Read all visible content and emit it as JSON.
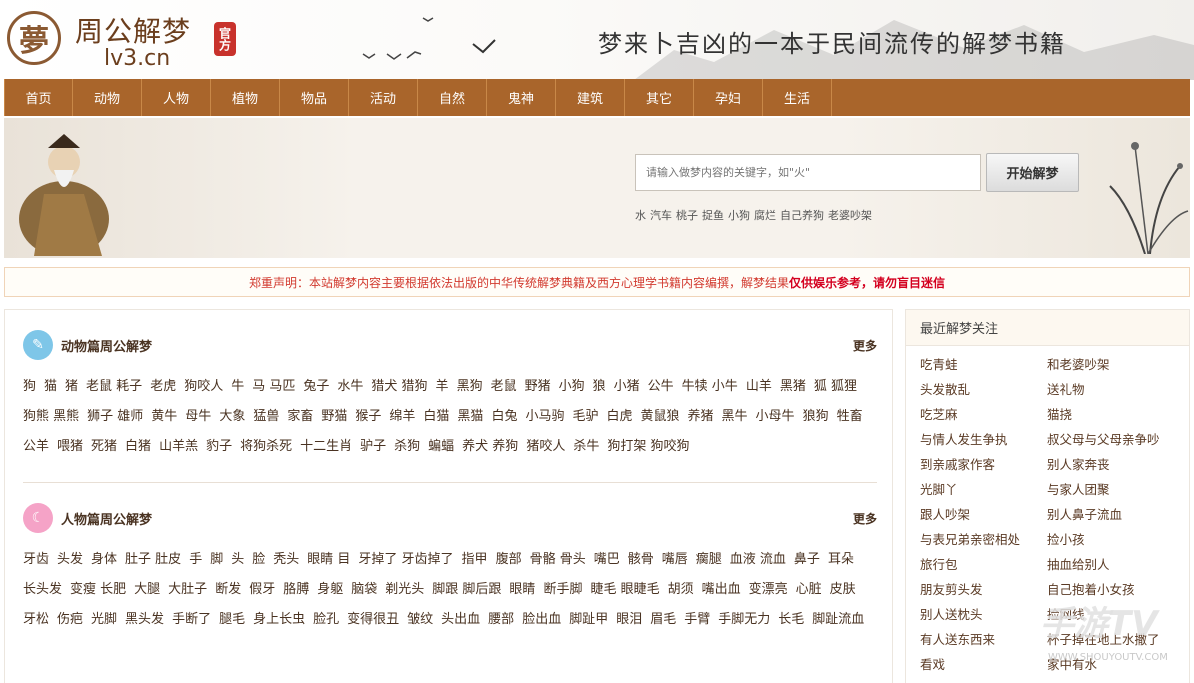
{
  "header": {
    "logo_char": "夢",
    "site_name": "周公解梦",
    "domain": "lv3.cn",
    "seal": "官方",
    "slogan": "梦来卜吉凶的一本于民间流传的解梦书籍"
  },
  "nav": {
    "items": [
      "首页",
      "动物",
      "人物",
      "植物",
      "物品",
      "活动",
      "自然",
      "鬼神",
      "建筑",
      "其它",
      "孕妇",
      "生活"
    ]
  },
  "search": {
    "placeholder": "请输入做梦内容的关键字，如\"火\"",
    "button_label": "开始解梦",
    "hot_keywords": [
      "水",
      "汽车",
      "桃子",
      "捉鱼",
      "小狗",
      "腐烂",
      "自己养狗",
      "老婆吵架"
    ]
  },
  "notice": {
    "text": "郑重声明：本站解梦内容主要根据依法出版的中华传统解梦典籍及西方心理学书籍内容编撰，解梦结果",
    "bold_text": "仅供娱乐参考，请勿盲目迷信"
  },
  "animals": {
    "title": "动物篇周公解梦",
    "more": "更多",
    "tags": [
      "狗",
      "猫",
      "猪",
      "老鼠 耗子",
      "老虎",
      "狗咬人",
      "牛",
      "马 马匹",
      "兔子",
      "水牛",
      "猎犬 猎狗",
      "羊",
      "黑狗",
      "老鼠",
      "野猪",
      "小狗",
      "狼",
      "小猪",
      "公牛",
      "牛犊 小牛",
      "山羊",
      "黑猪",
      "狐 狐狸",
      "狗熊 黑熊",
      "狮子 雄师",
      "黄牛",
      "母牛",
      "大象",
      "猛兽",
      "家畜",
      "野猫",
      "猴子",
      "绵羊",
      "白猫",
      "黑猫",
      "白兔",
      "小马驹",
      "毛驴",
      "白虎",
      "黄鼠狼",
      "养猪",
      "黑牛",
      "小母牛",
      "狼狗",
      "牲畜",
      "公羊",
      "喂猪",
      "死猪",
      "白猪",
      "山羊羔",
      "豹子",
      "将狗杀死",
      "十二生肖",
      "驴子",
      "杀狗",
      "蝙蝠",
      "养犬 养狗",
      "猪咬人",
      "杀牛",
      "狗打架 狗咬狗"
    ]
  },
  "people": {
    "title": "人物篇周公解梦",
    "more": "更多",
    "tags": [
      "牙齿",
      "头发",
      "身体",
      "肚子 肚皮",
      "手",
      "脚",
      "头",
      "脸",
      "秃头",
      "眼睛 目",
      "牙掉了 牙齿掉了",
      "指甲",
      "腹部",
      "骨骼 骨头",
      "嘴巴",
      "骸骨",
      "嘴唇",
      "瘸腿",
      "血液 流血",
      "鼻子",
      "耳朵",
      "长头发",
      "变瘦 长肥",
      "大腿",
      "大肚子",
      "断发",
      "假牙",
      "胳膊",
      "身躯",
      "脑袋",
      "剃光头",
      "脚跟 脚后跟",
      "眼睛",
      "断手脚",
      "睫毛 眼睫毛",
      "胡须",
      "嘴出血",
      "变漂亮",
      "心脏",
      "皮肤",
      "牙松",
      "伤疤",
      "光脚",
      "黑头发",
      "手断了",
      "腿毛",
      "身上长虫",
      "脸孔",
      "变得很丑",
      "皱纹",
      "头出血",
      "腰部",
      "脸出血",
      "脚趾甲",
      "眼泪",
      "眉毛",
      "手臂",
      "手脚无力",
      "长毛",
      "脚趾流血"
    ]
  },
  "sidebar": {
    "title": "最近解梦关注",
    "items": [
      "吃青蛙",
      "和老婆吵架",
      "头发散乱",
      "送礼物",
      "吃芝麻",
      "猫挠",
      "与情人发生争执",
      "叔父母与父母亲争吵",
      "到亲戚家作客",
      "别人家奔丧",
      "光脚丫",
      "与家人团聚",
      "跟人吵架",
      "别人鼻子流血",
      "与表兄弟亲密相处",
      "捡小孩",
      "旅行包",
      "抽血给别人",
      "朋友剪头发",
      "自己抱着小女孩",
      "别人送枕头",
      "捡网线",
      "有人送东西来",
      "杯子掉在地上水撒了",
      "看戏",
      "家中有水"
    ]
  },
  "watermark": {
    "title": "手游TV",
    "url": "WWW.SHOUYOUTV.COM"
  }
}
